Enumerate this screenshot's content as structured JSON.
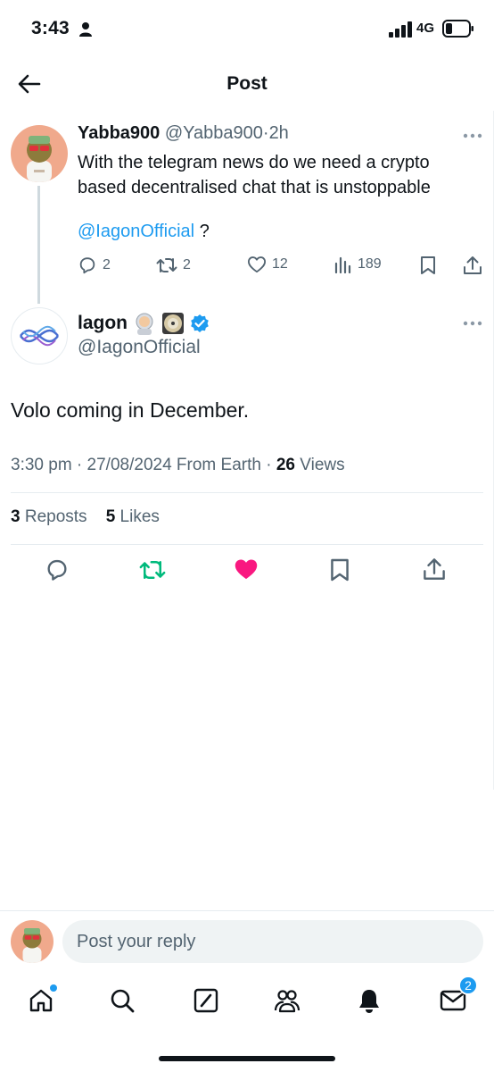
{
  "status_bar": {
    "time": "3:43",
    "network": "4G",
    "icons": [
      "person-icon",
      "signal-icon",
      "battery-icon"
    ]
  },
  "header": {
    "title": "Post",
    "back_icon": "arrow-left-icon"
  },
  "parent_post": {
    "display_name": "Yabba900",
    "handle": "@Yabba900",
    "separator": "·",
    "age": "2h",
    "text_line_1": "With the telegram news do we need a crypto",
    "text_line_2": "based decentralised chat that is unstoppable",
    "mention": "@IagonOfficial",
    "mention_suffix": "?",
    "actions": {
      "replies": "2",
      "reposts": "2",
      "likes": "12",
      "views": "189"
    }
  },
  "main_post": {
    "display_name": "lagon",
    "name_emojis": [
      "astronaut-emoji",
      "disc-emoji"
    ],
    "verified": true,
    "handle": "@IagonOfficial",
    "text": "Volo coming in December.",
    "time": "3:30 pm",
    "date": "27/08/2024",
    "source": "From Earth",
    "views_count": "26",
    "views_label": "Views",
    "reposts_count": "3",
    "reposts_label": "Reposts",
    "likes_count": "5",
    "likes_label": "Likes",
    "liked": true
  },
  "reply_bar": {
    "placeholder": "Post your reply"
  },
  "bottom_nav": {
    "items": [
      "home-icon",
      "search-icon",
      "compose-icon",
      "communities-icon",
      "notifications-icon",
      "messages-icon"
    ],
    "messages_badge": "2"
  },
  "colors": {
    "accent": "#1d9bf0",
    "text": "#0f1419",
    "muted": "#536471",
    "like": "#f91880",
    "repost": "#00ba7c",
    "divider": "#e6ecf0"
  }
}
